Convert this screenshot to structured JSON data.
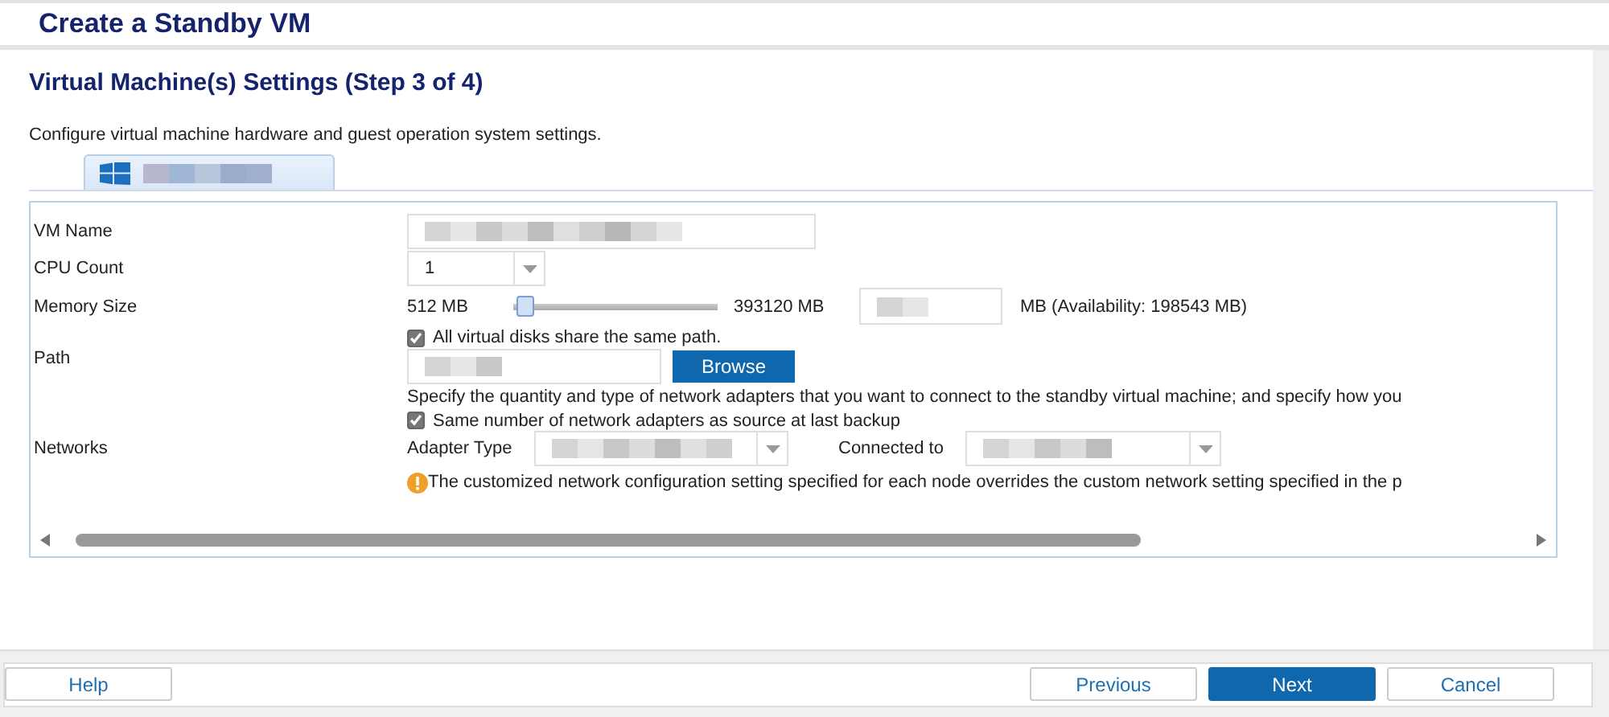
{
  "window": {
    "title": "Create a Standby VM"
  },
  "step": {
    "title": "Virtual Machine(s) Settings (Step 3 of 4)",
    "description": "Configure virtual machine hardware and guest operation system settings."
  },
  "tabs": [
    {
      "selected": true
    }
  ],
  "form": {
    "vm_name": {
      "label": "VM Name"
    },
    "cpu_count": {
      "label": "CPU Count",
      "value": "1"
    },
    "memory": {
      "label": "Memory Size",
      "min": "512 MB",
      "max": "393120 MB",
      "level": 0.02,
      "unit": "MB (Availability: 198543 MB)"
    },
    "share_path": {
      "label": "All virtual disks share the same path.",
      "checked": true
    },
    "path": {
      "label": "Path",
      "button": "Browse"
    },
    "networks": {
      "label": "Networks",
      "description": "Specify the quantity and type of network adapters that you want to connect to the standby virtual machine; and specify how you",
      "same_count": {
        "label": "Same number of network adapters as source at last backup",
        "checked": true
      },
      "adapter_type_label": "Adapter Type",
      "connected_to_label": "Connected to",
      "warning": "The customized network configuration setting specified for each node overrides the custom network setting specified in the p"
    }
  },
  "buttons": [
    {
      "label": "Help",
      "primary": false
    },
    {
      "label": "Previous",
      "primary": false
    },
    {
      "label": "Next",
      "primary": true
    },
    {
      "label": "Cancel",
      "primary": false
    }
  ]
}
